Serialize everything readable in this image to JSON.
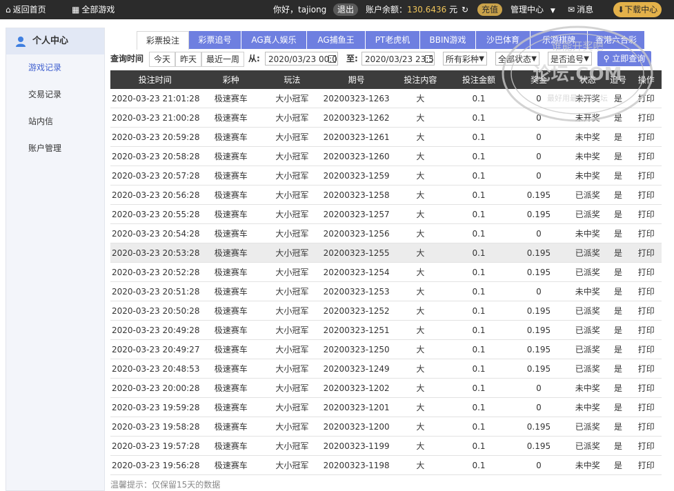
{
  "topbar": {
    "home": "返回首页",
    "all_games": "全部游戏",
    "greeting": "你好，tajiong",
    "logout": "退出",
    "balance_label": "账户余额：",
    "balance_value": "130.6436",
    "balance_unit": "元",
    "recharge": "充值",
    "manage": "管理中心",
    "message": "消息",
    "download": "下载中心"
  },
  "sidebar": {
    "title": "个人中心",
    "items": [
      "游戏记录",
      "交易记录",
      "站内信",
      "账户管理"
    ]
  },
  "tabs": [
    "彩票投注",
    "彩票追号",
    "AG真人娱乐",
    "AG捕鱼王",
    "PT老虎机",
    "BBIN游戏",
    "沙巴体育",
    "乐游棋牌",
    "香港六合彩"
  ],
  "query": {
    "label": "查询时间",
    "today": "今天",
    "yesterday": "昨天",
    "week": "最近一周",
    "from_label": "从:",
    "from_value": "2020/03/23 00:0",
    "to_label": "至:",
    "to_value": "2020/03/23 23:5",
    "lottery_select": "所有彩种",
    "status_select": "全部状态",
    "chase_select": "是否追号",
    "search": "立即查询"
  },
  "table": {
    "headers": [
      "投注时间",
      "彩种",
      "玩法",
      "期号",
      "投注内容",
      "投注金额",
      "奖金",
      "状态",
      "追号",
      "操作"
    ],
    "rows": [
      [
        "2020-03-23 21:01:28",
        "极速赛车",
        "大小冠军",
        "20200323-1263",
        "大",
        "0.1",
        "0",
        "未开奖",
        "是",
        "打印"
      ],
      [
        "2020-03-23 21:00:28",
        "极速赛车",
        "大小冠军",
        "20200323-1262",
        "大",
        "0.1",
        "0",
        "未开奖",
        "是",
        "打印"
      ],
      [
        "2020-03-23 20:59:28",
        "极速赛车",
        "大小冠军",
        "20200323-1261",
        "大",
        "0.1",
        "0",
        "未中奖",
        "是",
        "打印"
      ],
      [
        "2020-03-23 20:58:28",
        "极速赛车",
        "大小冠军",
        "20200323-1260",
        "大",
        "0.1",
        "0",
        "未中奖",
        "是",
        "打印"
      ],
      [
        "2020-03-23 20:57:28",
        "极速赛车",
        "大小冠军",
        "20200323-1259",
        "大",
        "0.1",
        "0",
        "未中奖",
        "是",
        "打印"
      ],
      [
        "2020-03-23 20:56:28",
        "极速赛车",
        "大小冠军",
        "20200323-1258",
        "大",
        "0.1",
        "0.195",
        "已派奖",
        "是",
        "打印"
      ],
      [
        "2020-03-23 20:55:28",
        "极速赛车",
        "大小冠军",
        "20200323-1257",
        "大",
        "0.1",
        "0.195",
        "已派奖",
        "是",
        "打印"
      ],
      [
        "2020-03-23 20:54:28",
        "极速赛车",
        "大小冠军",
        "20200323-1256",
        "大",
        "0.1",
        "0",
        "未中奖",
        "是",
        "打印"
      ],
      [
        "2020-03-23 20:53:28",
        "极速赛车",
        "大小冠军",
        "20200323-1255",
        "大",
        "0.1",
        "0.195",
        "已派奖",
        "是",
        "打印"
      ],
      [
        "2020-03-23 20:52:28",
        "极速赛车",
        "大小冠军",
        "20200323-1254",
        "大",
        "0.1",
        "0.195",
        "已派奖",
        "是",
        "打印"
      ],
      [
        "2020-03-23 20:51:28",
        "极速赛车",
        "大小冠军",
        "20200323-1253",
        "大",
        "0.1",
        "0",
        "未中奖",
        "是",
        "打印"
      ],
      [
        "2020-03-23 20:50:28",
        "极速赛车",
        "大小冠军",
        "20200323-1252",
        "大",
        "0.1",
        "0.195",
        "已派奖",
        "是",
        "打印"
      ],
      [
        "2020-03-23 20:49:28",
        "极速赛车",
        "大小冠军",
        "20200323-1251",
        "大",
        "0.1",
        "0.195",
        "已派奖",
        "是",
        "打印"
      ],
      [
        "2020-03-23 20:49:27",
        "极速赛车",
        "大小冠军",
        "20200323-1250",
        "大",
        "0.1",
        "0.195",
        "已派奖",
        "是",
        "打印"
      ],
      [
        "2020-03-23 20:48:53",
        "极速赛车",
        "大小冠军",
        "20200323-1249",
        "大",
        "0.1",
        "0.195",
        "已派奖",
        "是",
        "打印"
      ],
      [
        "2020-03-23 20:00:28",
        "极速赛车",
        "大小冠军",
        "20200323-1202",
        "大",
        "0.1",
        "0",
        "未中奖",
        "是",
        "打印"
      ],
      [
        "2020-03-23 19:59:28",
        "极速赛车",
        "大小冠军",
        "20200323-1201",
        "大",
        "0.1",
        "0",
        "未中奖",
        "是",
        "打印"
      ],
      [
        "2020-03-23 19:58:28",
        "极速赛车",
        "大小冠军",
        "20200323-1200",
        "大",
        "0.1",
        "0.195",
        "已派奖",
        "是",
        "打印"
      ],
      [
        "2020-03-23 19:57:28",
        "极速赛车",
        "大小冠军",
        "20200323-1199",
        "大",
        "0.1",
        "0.195",
        "已派奖",
        "是",
        "打印"
      ],
      [
        "2020-03-23 19:56:28",
        "极速赛车",
        "大小冠军",
        "20200323-1198",
        "大",
        "0.1",
        "0",
        "未中奖",
        "是",
        "打印"
      ]
    ],
    "highlight_row": 8
  },
  "footer": "温馨提示：仅保留15天的数据",
  "colors": {
    "accent": "#6e7fe0",
    "won": "#e8424a",
    "topbar": "#2b2b2b",
    "balance": "#f1c65b"
  },
  "watermark": {
    "line1": "谁能开奖吧",
    "line2": "论坛.COM",
    "line3": "最好用最全的论坛"
  }
}
